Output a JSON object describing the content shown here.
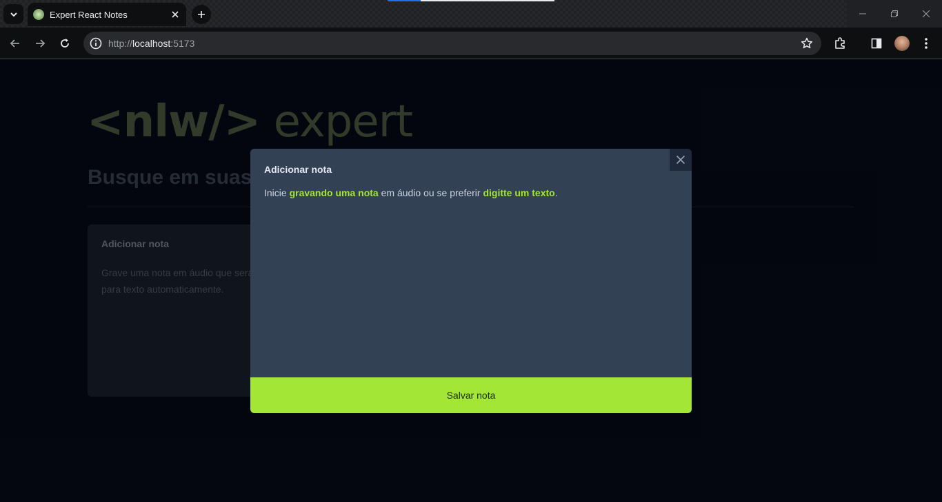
{
  "browser": {
    "tab_title": "Expert React Notes",
    "url_scheme": "http://",
    "url_host": "localhost",
    "url_port": ":5173"
  },
  "page": {
    "logo_prefix": "<nlw/>",
    "logo_word": "expert",
    "search_heading": "Busque em suas notas...",
    "add_card": {
      "title": "Adicionar nota",
      "description": "Grave uma nota em áudio que será convertida para texto automaticamente."
    }
  },
  "modal": {
    "title": "Adicionar nota",
    "text_start": "Inicie ",
    "link_record": "gravando uma nota",
    "text_middle": " em áudio ou se preferir ",
    "link_type": "digitte um texto",
    "text_end": ".",
    "save_label": "Salvar nota"
  },
  "colors": {
    "accent": "#a3e635",
    "modal_bg": "#334155",
    "page_bg": "#060a17"
  }
}
